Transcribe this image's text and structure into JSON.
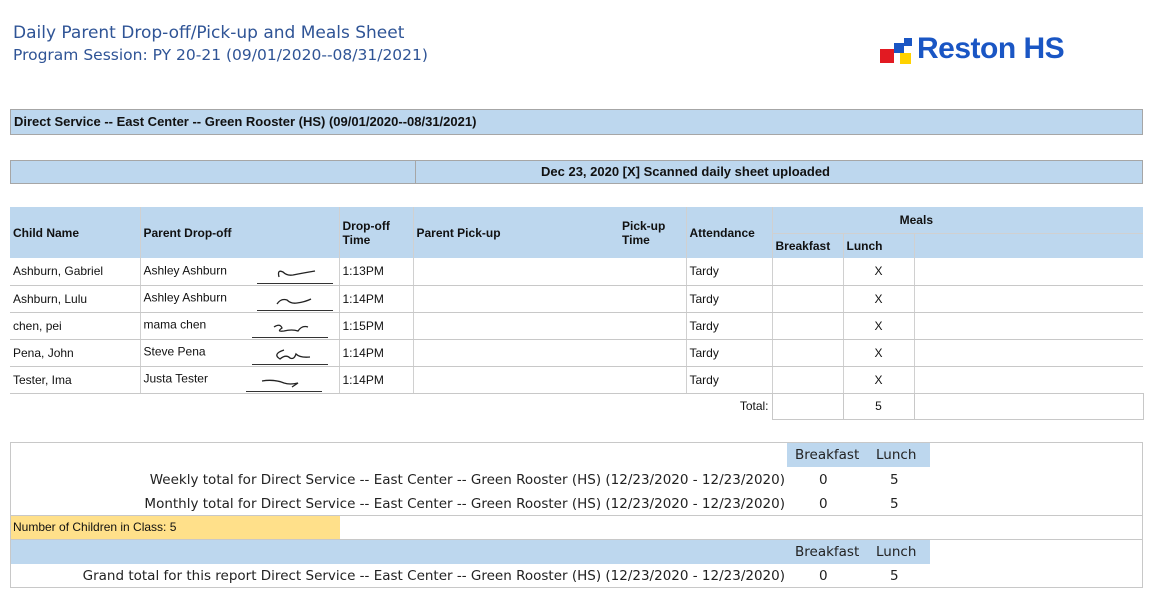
{
  "header": {
    "title": "Daily Parent Drop-off/Pick-up and Meals Sheet",
    "subtitle": "Program Session: PY 20-21 (09/01/2020--08/31/2021)",
    "logo_text": "Reston HS"
  },
  "service_band": "Direct Service -- East Center -- Green Rooster (HS) (09/01/2020--08/31/2021)",
  "date_band": "Dec 23, 2020  [X] Scanned daily sheet uploaded",
  "columns": {
    "child_name": "Child Name",
    "parent_dropoff": "Parent Drop-off",
    "dropoff_time": "Drop-off Time",
    "parent_pickup": "Parent Pick-up",
    "pickup_time": "Pick-up Time",
    "attendance": "Attendance",
    "meals": "Meals",
    "breakfast": "Breakfast",
    "lunch": "Lunch"
  },
  "rows": [
    {
      "child": "Ashburn, Gabriel",
      "parent": "Ashley Ashburn",
      "dropoff_time": "1:13PM",
      "attendance": "Tardy",
      "breakfast": "",
      "lunch": "X"
    },
    {
      "child": "Ashburn, Lulu",
      "parent": "Ashley Ashburn",
      "dropoff_time": "1:14PM",
      "attendance": "Tardy",
      "breakfast": "",
      "lunch": "X"
    },
    {
      "child": "chen, pei",
      "parent": "mama chen",
      "dropoff_time": "1:15PM",
      "attendance": "Tardy",
      "breakfast": "",
      "lunch": "X"
    },
    {
      "child": "Pena, John",
      "parent": "Steve Pena",
      "dropoff_time": "1:14PM",
      "attendance": "Tardy",
      "breakfast": "",
      "lunch": "X"
    },
    {
      "child": "Tester, Ima",
      "parent": "Justa Tester",
      "dropoff_time": "1:14PM",
      "attendance": "Tardy",
      "breakfast": "",
      "lunch": "X"
    }
  ],
  "total": {
    "label": "Total:",
    "breakfast": "",
    "lunch": "5"
  },
  "summary": {
    "breakfast_label": "Breakfast",
    "lunch_label": "Lunch",
    "weekly_label": "Weekly total for Direct Service -- East Center -- Green Rooster (HS) (12/23/2020 - 12/23/2020)",
    "weekly_breakfast": "0",
    "weekly_lunch": "5",
    "monthly_label": "Monthly total for Direct Service -- East Center -- Green Rooster (HS) (12/23/2020 - 12/23/2020)",
    "monthly_breakfast": "0",
    "monthly_lunch": "5",
    "children_count": "Number of Children in Class: 5",
    "grand_label": "Grand total for this report Direct Service -- East Center -- Green Rooster (HS) (12/23/2020 - 12/23/2020)",
    "grand_breakfast": "0",
    "grand_lunch": "5"
  }
}
